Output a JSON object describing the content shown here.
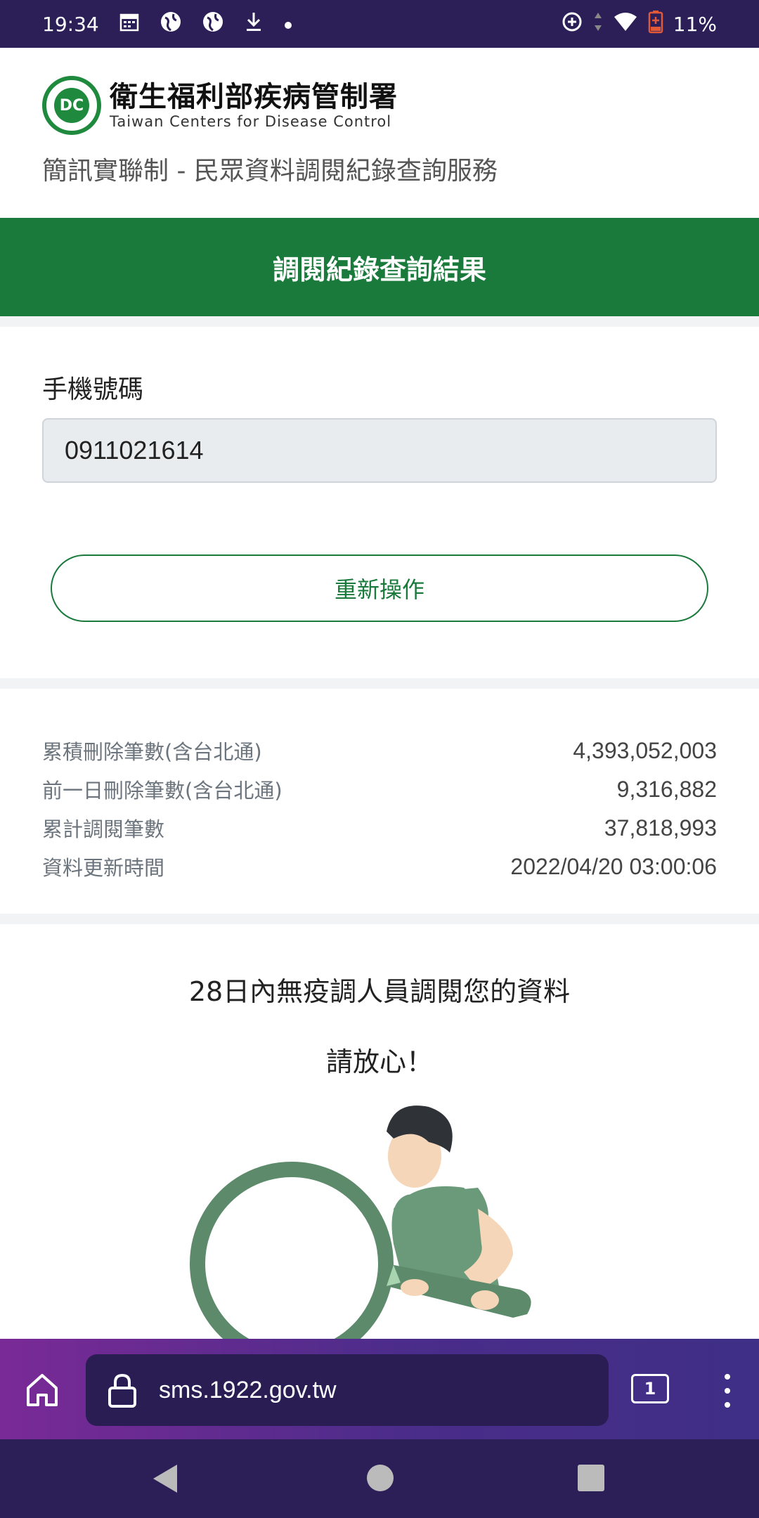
{
  "status_bar": {
    "time": "19:34",
    "battery": "11%",
    "icons": [
      "calendar-icon",
      "globe-icon",
      "globe-icon",
      "download-icon",
      "dot-icon",
      "data-saver-icon",
      "data-arrows-icon",
      "wifi-icon",
      "battery-icon"
    ]
  },
  "header": {
    "org_name_cn": "衛生福利部疾病管制署",
    "org_name_en": "Taiwan Centers for Disease Control",
    "service_title": "簡訊實聯制 - 民眾資料調閱紀錄查詢服務"
  },
  "banner": {
    "title": "調閱紀錄查詢結果"
  },
  "form": {
    "phone_label": "手機號碼",
    "phone_value": "0911021614",
    "redo_button": "重新操作"
  },
  "stats": [
    {
      "label": "累積刪除筆數(含台北通)",
      "value": "4,393,052,003"
    },
    {
      "label": "前一日刪除筆數(含台北通)",
      "value": "9,316,882"
    },
    {
      "label": "累計調閱筆數",
      "value": "37,818,993"
    },
    {
      "label": "資料更新時間",
      "value": "2022/04/20 03:00:06"
    }
  ],
  "result": {
    "message_line1": "28日內無疫調人員調閱您的資料",
    "message_line2": "請放心！"
  },
  "browser": {
    "url": "sms.1922.gov.tw",
    "tab_count": "1"
  },
  "colors": {
    "primary_green": "#1a7a3c",
    "status_bar": "#2c1f57",
    "illustration_green": "#5a8a6a"
  }
}
